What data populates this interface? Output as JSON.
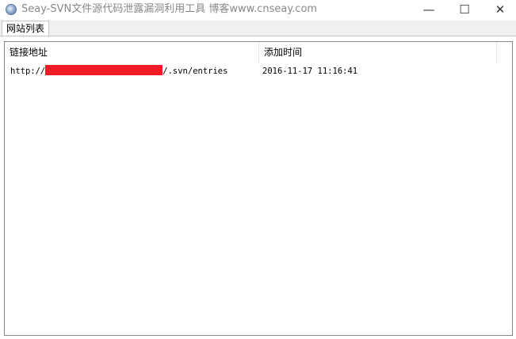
{
  "window": {
    "title": "Seay-SVN文件源代码泄露漏洞利用工具  博客www.cnseay.com",
    "min_glyph": "—",
    "max_glyph": "☐",
    "close_glyph": "✕"
  },
  "tabs": [
    {
      "label": "网站列表",
      "selected": true
    }
  ],
  "list": {
    "columns": [
      "链接地址",
      "添加时间"
    ],
    "rows": [
      {
        "url_prefix": "http://",
        "url_suffix": "/.svn/entries",
        "redacted": true,
        "time": "2016-11-17 11:16:41"
      }
    ]
  },
  "colors": {
    "redaction": "#ee1c25",
    "title_text": "#888888",
    "border": "#828790"
  }
}
